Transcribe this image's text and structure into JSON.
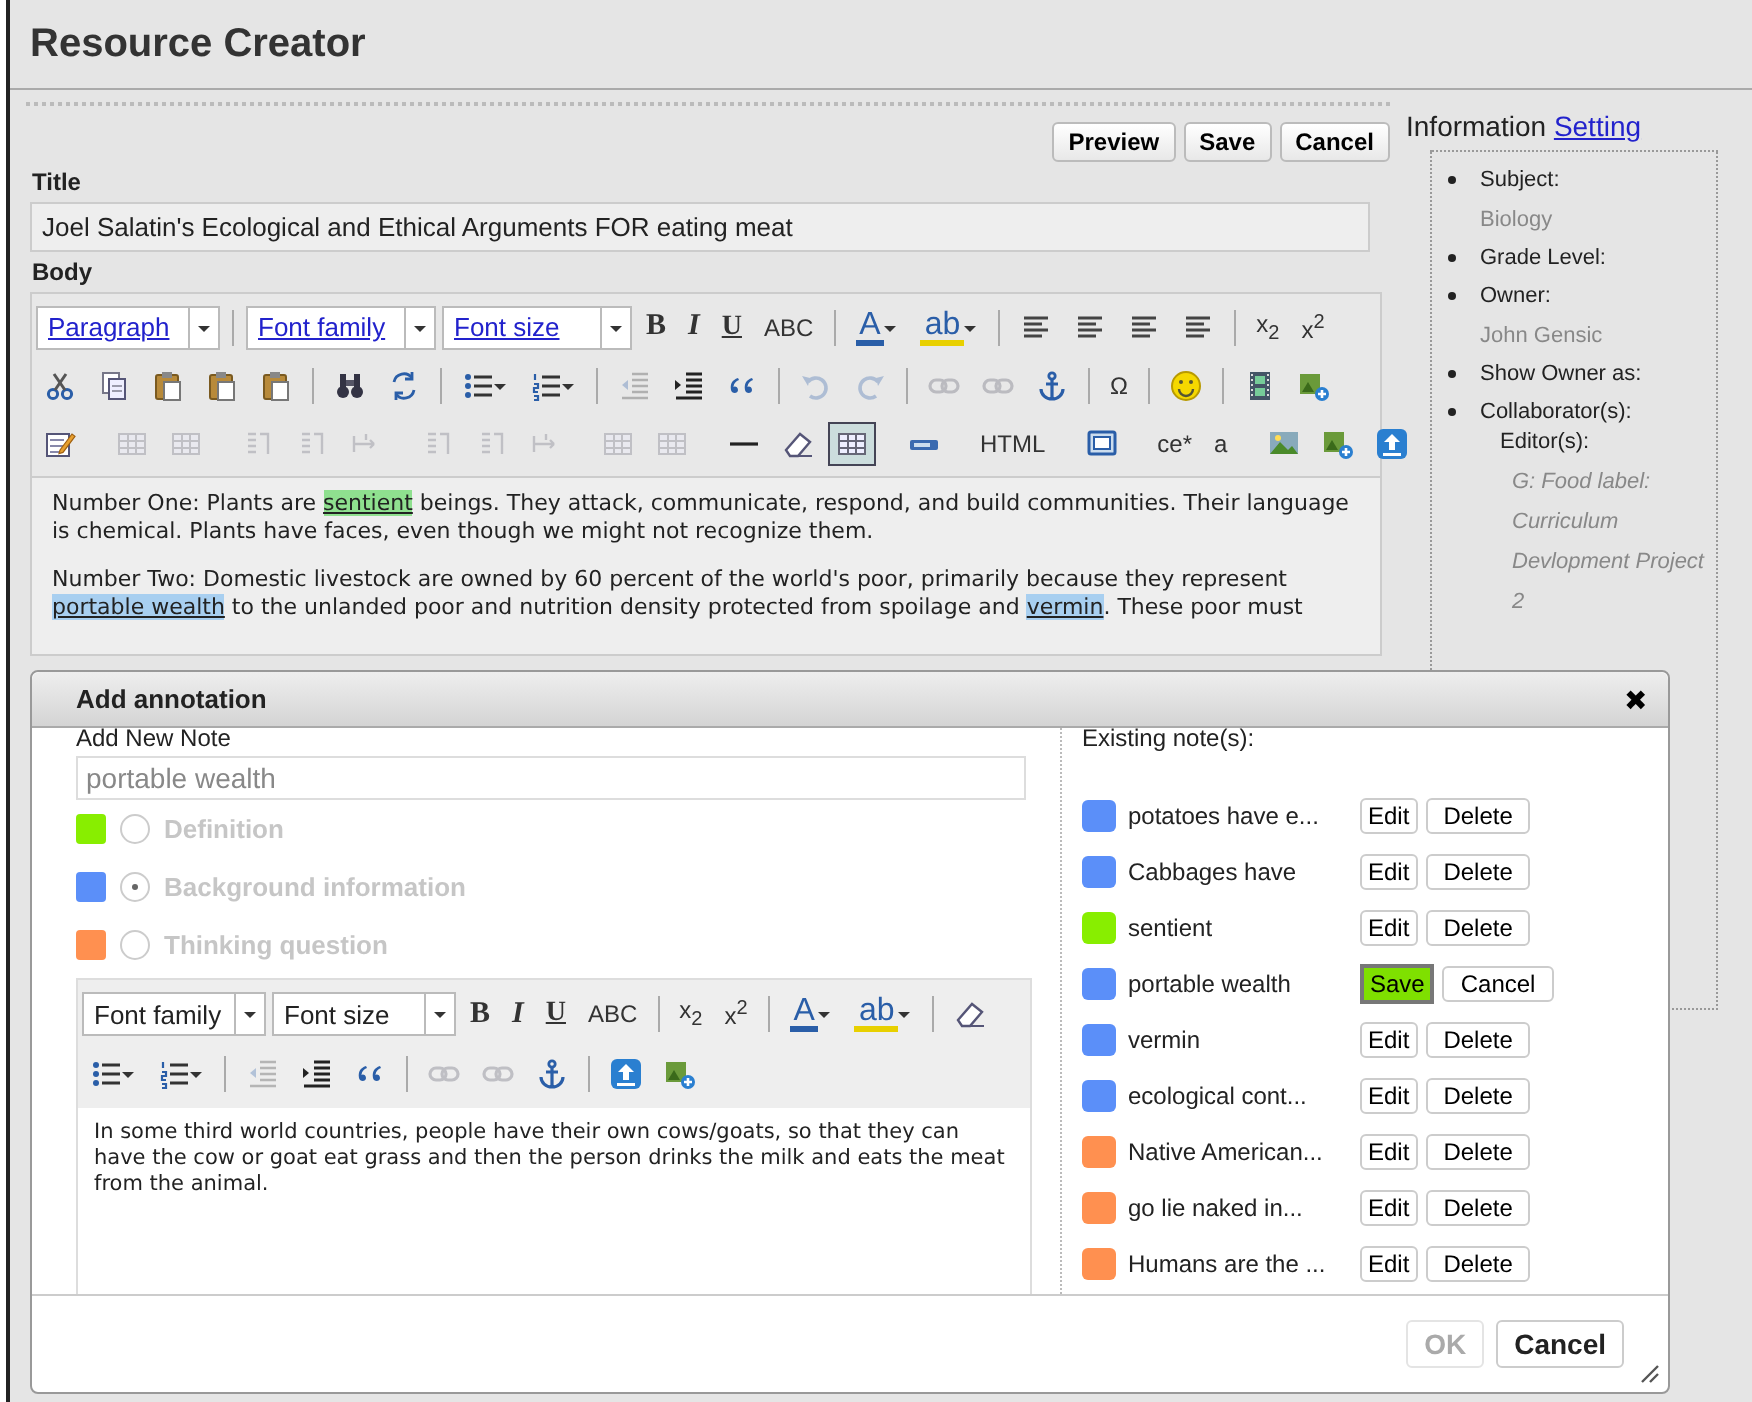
{
  "app": {
    "title": "Resource Creator"
  },
  "actions": [
    "Preview",
    "Save",
    "Cancel"
  ],
  "title_field": {
    "label": "Title",
    "value": "Joel Salatin's Ecological and Ethical Arguments FOR eating meat"
  },
  "body": {
    "label": "Body",
    "toolbar": [
      [
        {
          "kind": "select",
          "label": "Paragraph"
        },
        {
          "kind": "separator"
        },
        {
          "kind": "select",
          "label": "Font family"
        },
        {
          "kind": "select",
          "label": "Font size"
        },
        {
          "kind": "bold",
          "label": "B"
        },
        {
          "kind": "italic",
          "label": "I"
        },
        {
          "kind": "underline",
          "label": "U"
        },
        {
          "kind": "glyph",
          "label": "ABC"
        },
        {
          "kind": "separator"
        },
        {
          "kind": "color",
          "label": "A",
          "color": "#2a5ea8",
          "dropdown": true
        },
        {
          "kind": "color",
          "label": "ab",
          "color": "#e8d000",
          "dropdown": true
        },
        {
          "kind": "separator"
        },
        {
          "kind": "icon",
          "disabled": false,
          "active": false
        },
        {
          "kind": "icon",
          "disabled": false,
          "active": false
        },
        {
          "kind": "icon",
          "disabled": false,
          "active": false
        },
        {
          "kind": "icon",
          "disabled": false,
          "active": false
        },
        {
          "kind": "separator"
        },
        {
          "kind": "glyph",
          "label": "x$_{2}$"
        },
        {
          "kind": "glyph",
          "label": "x$^{2}$"
        }
      ],
      [
        {
          "kind": "icon",
          "disabled": false,
          "active": false
        },
        {
          "kind": "icon",
          "disabled": false,
          "active": false
        },
        {
          "kind": "icon",
          "disabled": false,
          "active": false
        },
        {
          "kind": "icon",
          "disabled": false,
          "active": false
        },
        {
          "kind": "icon",
          "disabled": false,
          "active": false
        },
        {
          "kind": "separator"
        },
        {
          "kind": "icon",
          "disabled": false,
          "active": false
        },
        {
          "kind": "icon",
          "disabled": false,
          "active": false
        },
        {
          "kind": "separator"
        },
        {
          "kind": "icon",
          "disabled": false,
          "active": false,
          "dropdown": true
        },
        {
          "kind": "icon",
          "disabled": false,
          "active": false,
          "dropdown": true
        },
        {
          "kind": "separator"
        },
        {
          "kind": "icon",
          "disabled": true,
          "active": false
        },
        {
          "kind": "icon",
          "disabled": false,
          "active": false
        },
        {
          "kind": "icon",
          "disabled": false,
          "active": false
        },
        {
          "kind": "separator"
        },
        {
          "kind": "icon",
          "disabled": true,
          "active": false
        },
        {
          "kind": "icon",
          "disabled": true,
          "active": false
        },
        {
          "kind": "separator"
        },
        {
          "kind": "icon",
          "disabled": true,
          "active": false
        },
        {
          "kind": "icon",
          "disabled": true,
          "active": false
        },
        {
          "kind": "icon",
          "disabled": false,
          "active": false
        },
        {
          "kind": "separator"
        },
        {
          "kind": "glyph",
          "label": "Ω"
        },
        {
          "kind": "separator"
        },
        {
          "kind": "icon",
          "disabled": false,
          "active": false
        },
        {
          "kind": "separator"
        },
        {
          "kind": "icon",
          "disabled": false,
          "active": false
        },
        {
          "kind": "icon",
          "disabled": false,
          "active": false
        }
      ],
      [
        {
          "kind": "icon",
          "disabled": false,
          "active": false
        },
        {
          "kind": "separator"
        },
        {
          "kind": "icon",
          "disabled": true,
          "active": false
        },
        {
          "kind": "icon",
          "disabled": true,
          "active": false
        },
        {
          "kind": "separator"
        },
        {
          "kind": "icon",
          "disabled": true,
          "active": false
        },
        {
          "kind": "icon",
          "disabled": true,
          "active": false
        },
        {
          "kind": "icon",
          "disabled": true,
          "active": false
        },
        {
          "kind": "separator"
        },
        {
          "kind": "icon",
          "disabled": true,
          "active": false
        },
        {
          "kind": "icon",
          "disabled": true,
          "active": false
        },
        {
          "kind": "icon",
          "disabled": true,
          "active": false
        },
        {
          "kind": "separator"
        },
        {
          "kind": "icon",
          "disabled": true,
          "active": false
        },
        {
          "kind": "icon",
          "disabled": true,
          "active": false
        },
        {
          "kind": "separator"
        },
        {
          "kind": "icon",
          "disabled": false,
          "active": false
        },
        {
          "kind": "icon",
          "disabled": false,
          "active": false
        },
        {
          "kind": "icon",
          "disabled": false,
          "active": true
        },
        {
          "kind": "separator"
        },
        {
          "kind": "icon",
          "disabled": false,
          "active": false
        },
        {
          "kind": "separator"
        },
        {
          "kind": "glyph",
          "label": "HTML"
        },
        {
          "kind": "separator"
        },
        {
          "kind": "icon",
          "disabled": false,
          "active": false
        },
        {
          "kind": "separator"
        },
        {
          "kind": "glyph",
          "label": "ce*"
        },
        {
          "kind": "glyph",
          "label": "a"
        },
        {
          "kind": "separator"
        },
        {
          "kind": "icon",
          "disabled": false,
          "active": false
        },
        {
          "kind": "icon",
          "disabled": false,
          "active": false
        },
        {
          "kind": "icon",
          "disabled": false,
          "active": false
        }
      ]
    ],
    "paragraphs": [
      [
        {
          "text": "Number One: Plants are "
        },
        {
          "text": "sentient",
          "color": "#8fe08f"
        },
        {
          "text": " beings. They attack, communicate, respond, and build communities. Their language is chemical. Plants have faces, even though we might not recognize them."
        }
      ],
      [
        {
          "text": "Number Two: Domestic livestock are owned by 60 percent of the world's poor, primarily because they represent "
        },
        {
          "text": "portable wealth",
          "color": "#a8cff0"
        },
        {
          "text": " to the unlanded poor and nutrition density protected from spoilage and "
        },
        {
          "text": "vermin",
          "color": "#a8cff0"
        },
        {
          "text": ". These poor must"
        }
      ]
    ]
  },
  "info": {
    "title": "Information",
    "link": "Setting",
    "items": [
      {
        "label": "Subject:",
        "value": "Biology"
      },
      {
        "label": "Grade Level:"
      },
      {
        "label": "Owner:",
        "value": "John Gensic"
      },
      {
        "label": "Show Owner as:"
      },
      {
        "label": "Collaborator(s):",
        "sublabel": "Editor(s):",
        "values": [
          "G: Food label:",
          "Curriculum",
          "Devlopment Project",
          "2"
        ]
      }
    ]
  },
  "dialog": {
    "title": "Add annotation",
    "close": "✖",
    "new_note": {
      "label": "Add New Note",
      "placeholder": "portable wealth"
    },
    "types": {
      "disabled": true,
      "options": [
        {
          "label": "Definition",
          "color": "#88ee00",
          "selected": false
        },
        {
          "label": "Background information",
          "color": "#5b8ff9",
          "selected": true
        },
        {
          "label": "Thinking question",
          "color": "#ff9050",
          "selected": false
        }
      ]
    },
    "toolbar": [
      [
        {
          "kind": "select",
          "label": "Font family"
        },
        {
          "kind": "select",
          "label": "Font size"
        },
        {
          "kind": "bold",
          "label": "B"
        },
        {
          "kind": "italic",
          "label": "I"
        },
        {
          "kind": "underline",
          "label": "U"
        },
        {
          "kind": "glyph",
          "label": "ABC"
        },
        {
          "kind": "separator"
        },
        {
          "kind": "glyph",
          "label": "x$_{2}$"
        },
        {
          "kind": "glyph",
          "label": "x$^{2}$"
        },
        {
          "kind": "separator"
        },
        {
          "kind": "color",
          "label": "A",
          "color": "#2a5ea8",
          "dropdown": true
        },
        {
          "kind": "color",
          "label": "ab",
          "color": "#e8d000",
          "dropdown": true
        },
        {
          "kind": "separator"
        },
        {
          "kind": "icon",
          "disabled": false,
          "active": false
        }
      ],
      [
        {
          "kind": "icon",
          "disabled": false,
          "active": false,
          "dropdown": true
        },
        {
          "kind": "icon",
          "disabled": false,
          "active": false,
          "dropdown": true
        },
        {
          "kind": "separator"
        },
        {
          "kind": "icon",
          "disabled": true,
          "active": false
        },
        {
          "kind": "icon",
          "disabled": false,
          "active": false
        },
        {
          "kind": "icon",
          "disabled": false,
          "active": false
        },
        {
          "kind": "separator"
        },
        {
          "kind": "icon",
          "disabled": true,
          "active": false
        },
        {
          "kind": "icon",
          "disabled": true,
          "active": false
        },
        {
          "kind": "icon",
          "disabled": false,
          "active": false
        },
        {
          "kind": "separator"
        },
        {
          "kind": "icon",
          "disabled": false,
          "active": false
        },
        {
          "kind": "icon",
          "disabled": false,
          "active": false
        }
      ]
    ],
    "note_text": "In some third world countries, people have their own cows/goats, so that they can have the cow or goat eat grass and then the person drinks the milk and eats the meat from the animal.",
    "existing_label": "Existing note(s):",
    "notes": [
      {
        "text": "potatoes have e...",
        "color": "#5b8ff9",
        "kind": "normal",
        "buttons": [
          "Edit",
          "Delete"
        ]
      },
      {
        "text": "Cabbages have",
        "color": "#5b8ff9",
        "kind": "normal",
        "buttons": [
          "Edit",
          "Delete"
        ]
      },
      {
        "text": "sentient",
        "color": "#88ee00",
        "kind": "normal",
        "buttons": [
          "Edit",
          "Delete"
        ]
      },
      {
        "text": "portable wealth",
        "color": "#5b8ff9",
        "kind": "editing",
        "buttons": [
          "Save",
          "Cancel"
        ]
      },
      {
        "text": "vermin",
        "color": "#5b8ff9",
        "kind": "normal",
        "buttons": [
          "Edit",
          "Delete"
        ]
      },
      {
        "text": "ecological cont...",
        "color": "#5b8ff9",
        "kind": "normal",
        "buttons": [
          "Edit",
          "Delete"
        ]
      },
      {
        "text": "Native American...",
        "color": "#ff9050",
        "kind": "normal",
        "buttons": [
          "Edit",
          "Delete"
        ]
      },
      {
        "text": "go lie naked in...",
        "color": "#ff9050",
        "kind": "normal",
        "buttons": [
          "Edit",
          "Delete"
        ]
      },
      {
        "text": "Humans are the ...",
        "color": "#ff9050",
        "kind": "normal",
        "buttons": [
          "Edit",
          "Delete"
        ]
      }
    ],
    "footer": [
      {
        "label": "OK",
        "disabled": true
      },
      {
        "label": "Cancel",
        "disabled": false
      }
    ]
  }
}
